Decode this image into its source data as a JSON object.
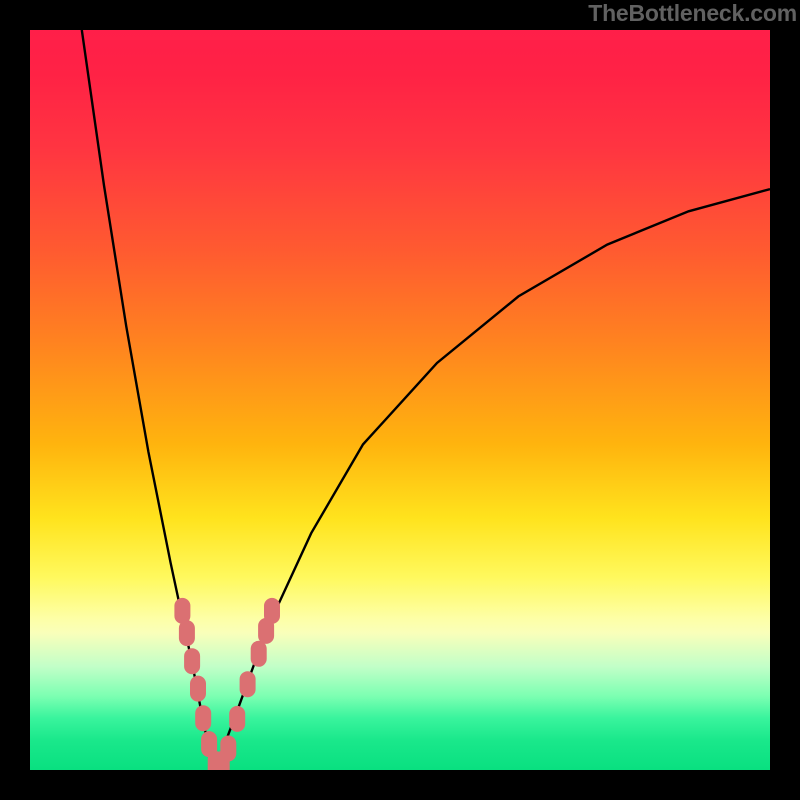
{
  "watermark_text": "TheBottleneck.com",
  "chart_data": {
    "type": "line",
    "title": "",
    "xlabel": "",
    "ylabel": "",
    "xlim": [
      0,
      100
    ],
    "ylim": [
      0,
      100
    ],
    "series": [
      {
        "name": "bottleneck-curve-left",
        "x": [
          7.0,
          10.0,
          13.0,
          16.0,
          19.0,
          22.0,
          23.5,
          25.0
        ],
        "values": [
          100.0,
          79.0,
          60.0,
          43.0,
          28.0,
          14.0,
          6.0,
          0.0
        ]
      },
      {
        "name": "bottleneck-curve-right",
        "x": [
          25.0,
          28.0,
          32.0,
          38.0,
          45.0,
          55.0,
          66.0,
          78.0,
          89.0,
          100.0
        ],
        "values": [
          0.0,
          8.0,
          19.0,
          32.0,
          44.0,
          55.0,
          64.0,
          71.0,
          75.5,
          78.5
        ]
      }
    ],
    "markers": {
      "name": "highlighted-points",
      "x": [
        20.6,
        21.2,
        21.9,
        22.7,
        23.4,
        24.2,
        25.1,
        25.9,
        26.8,
        28.0,
        29.4,
        30.9,
        31.9,
        32.7
      ],
      "values": [
        21.5,
        18.5,
        14.7,
        11.0,
        7.0,
        3.5,
        0.8,
        0.8,
        2.9,
        6.9,
        11.6,
        15.7,
        18.8,
        21.5
      ]
    },
    "gradient_axis": {
      "comment": "vertical color scale, value 100 at top (red) to 0 at bottom (green)",
      "stops": [
        {
          "value": 100,
          "color": "#ff1f49"
        },
        {
          "value": 70,
          "color": "#ff5b30"
        },
        {
          "value": 44,
          "color": "#ffb40e"
        },
        {
          "value": 26,
          "color": "#fff95e"
        },
        {
          "value": 18,
          "color": "#f9ffba"
        },
        {
          "value": 7,
          "color": "#39f49d"
        },
        {
          "value": 0,
          "color": "#09e080"
        }
      ]
    }
  }
}
